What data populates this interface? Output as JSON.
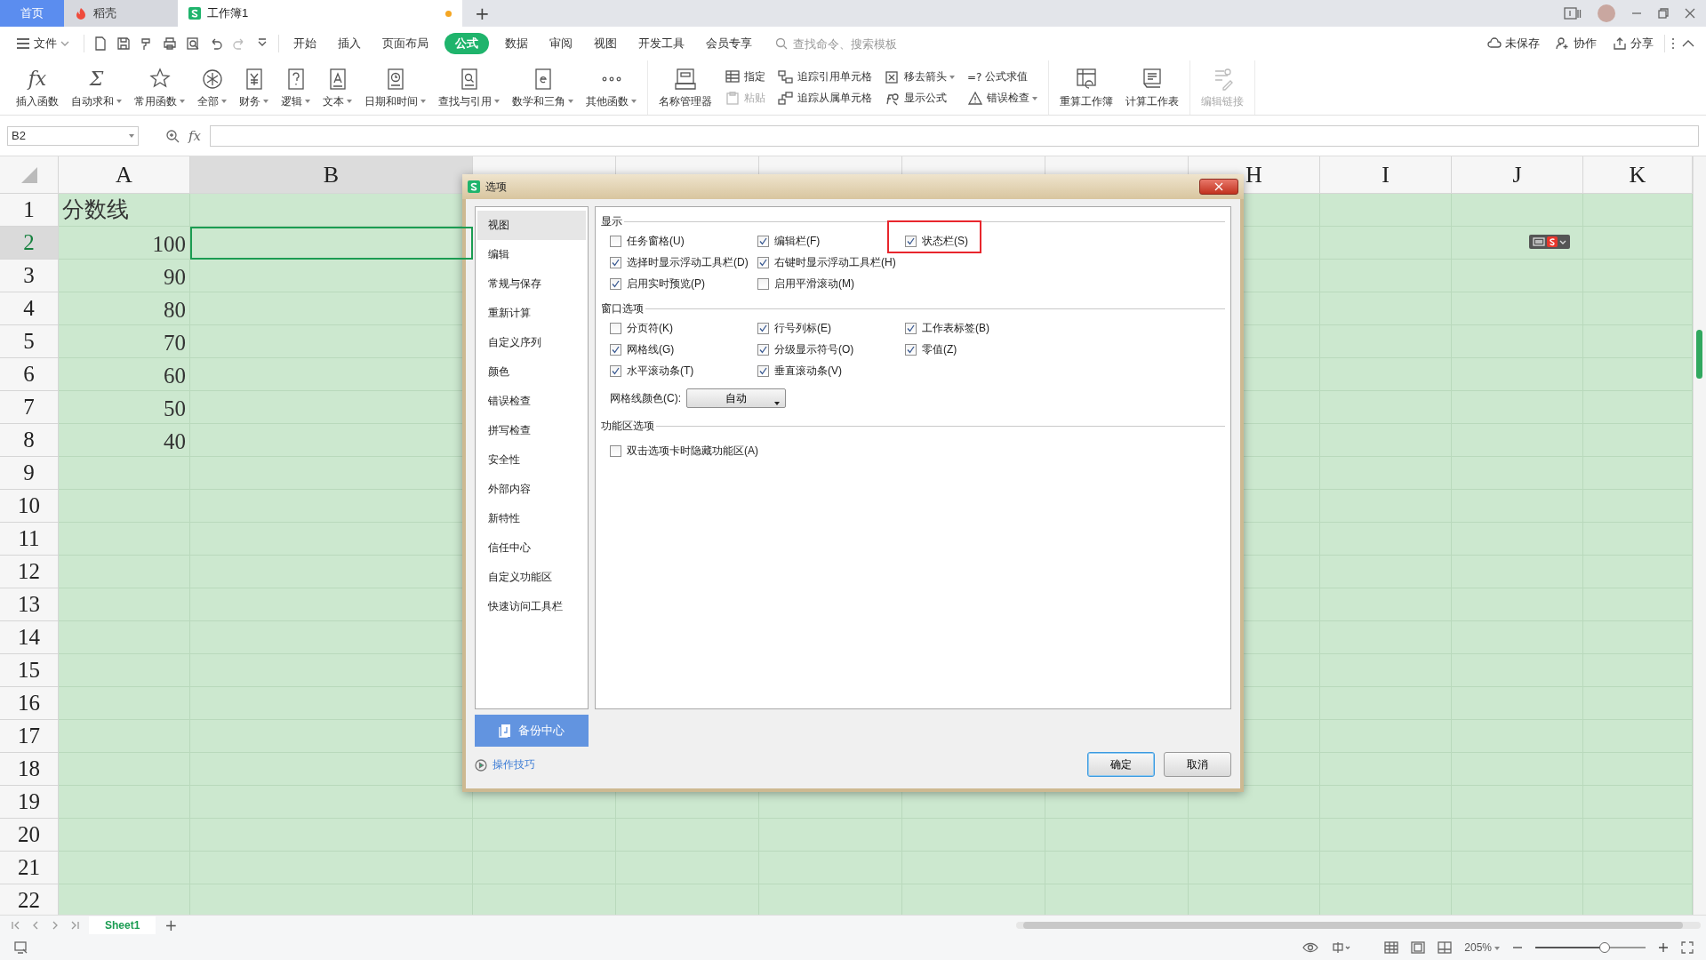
{
  "title_bar": {
    "tabs": [
      {
        "kind": "home",
        "label": "首页",
        "selected": false,
        "modified": false
      },
      {
        "kind": "docer",
        "label": "稻壳",
        "selected": false,
        "modified": false
      },
      {
        "kind": "workbook",
        "label": "工作簿1",
        "selected": true,
        "modified": true
      }
    ],
    "new_tab": "+"
  },
  "menu_bar": {
    "file": "文件",
    "tabs": [
      {
        "label": "开始",
        "selected": false
      },
      {
        "label": "插入",
        "selected": false
      },
      {
        "label": "页面布局",
        "selected": false
      },
      {
        "label": "公式",
        "selected": true
      },
      {
        "label": "数据",
        "selected": false
      },
      {
        "label": "审阅",
        "selected": false
      },
      {
        "label": "视图",
        "selected": false
      },
      {
        "label": "开发工具",
        "selected": false
      },
      {
        "label": "会员专享",
        "selected": false
      }
    ],
    "search": {
      "placeholder": "查找命令、搜索模板"
    },
    "actions": [
      "未保存",
      "协作",
      "分享"
    ]
  },
  "ribbon": {
    "groups": [
      {
        "items": [
          {
            "kind": "large",
            "label": "插入函数",
            "glyph": "fx",
            "dropdown": false,
            "disabled": false
          },
          {
            "kind": "large",
            "label": "自动求和",
            "glyph": "Σ",
            "dropdown": true,
            "disabled": false
          },
          {
            "kind": "large",
            "label": "常用函数",
            "dropdown": true,
            "disabled": false
          },
          {
            "kind": "large",
            "label": "全部",
            "dropdown": true,
            "disabled": false
          },
          {
            "kind": "large",
            "label": "财务",
            "dropdown": true,
            "disabled": false
          },
          {
            "kind": "large",
            "label": "逻辑",
            "dropdown": true,
            "disabled": false
          },
          {
            "kind": "large",
            "label": "文本",
            "dropdown": true,
            "disabled": false
          },
          {
            "kind": "large",
            "label": "日期和时间",
            "dropdown": true,
            "disabled": false
          },
          {
            "kind": "large",
            "label": "查找与引用",
            "dropdown": true,
            "disabled": false
          },
          {
            "kind": "large",
            "label": "数学和三角",
            "dropdown": true,
            "disabled": false
          },
          {
            "kind": "large",
            "label": "其他函数",
            "dropdown": true,
            "disabled": false
          }
        ]
      },
      {
        "items": [
          {
            "kind": "large",
            "label": "名称管理器",
            "dropdown": false,
            "disabled": false
          },
          {
            "kind": "small",
            "label": "指定",
            "dropdown": false,
            "disabled": false
          },
          {
            "kind": "small",
            "label": "粘贴",
            "dropdown": false,
            "disabled": true
          },
          {
            "kind": "small",
            "label": "追踪引用单元格",
            "dropdown": false,
            "disabled": false
          },
          {
            "kind": "small",
            "label": "追踪从属单元格",
            "dropdown": false,
            "disabled": false
          },
          {
            "kind": "small",
            "label": "移去箭头",
            "dropdown": true,
            "disabled": false
          },
          {
            "kind": "small",
            "label": "显示公式",
            "dropdown": false,
            "disabled": false
          },
          {
            "kind": "small",
            "label": "公式求值",
            "glyph": "=?",
            "dropdown": false,
            "disabled": false
          },
          {
            "kind": "small",
            "label": "错误检查",
            "dropdown": true,
            "disabled": false
          }
        ]
      },
      {
        "items": [
          {
            "kind": "large",
            "label": "重算工作簿",
            "dropdown": false,
            "disabled": false
          },
          {
            "kind": "large",
            "label": "计算工作表",
            "dropdown": false,
            "disabled": false
          }
        ]
      },
      {
        "items": [
          {
            "kind": "large",
            "label": "编辑链接",
            "dropdown": false,
            "disabled": true
          }
        ]
      }
    ]
  },
  "formula_bar": {
    "name_box": "B2",
    "function_glyph": "fx"
  },
  "sheet": {
    "columns": [
      {
        "label": "A",
        "selected": false
      },
      {
        "label": "B",
        "selected": true
      },
      {
        "selected": false
      },
      {
        "selected": false
      },
      {
        "selected": false
      },
      {
        "selected": false
      },
      {
        "selected": false
      },
      {
        "label": "H",
        "selected": false
      },
      {
        "label": "I",
        "selected": false
      },
      {
        "label": "J",
        "selected": false
      },
      {
        "label": "K",
        "selected": false
      }
    ],
    "rows": [
      {
        "label": "1",
        "selected": false,
        "cells": [
          {
            "text": "分数线",
            "selected": false
          }
        ]
      },
      {
        "label": "2",
        "selected": true,
        "cells": [
          {
            "text": "100",
            "selected": false
          },
          {
            "selected": true
          }
        ]
      },
      {
        "label": "3",
        "selected": false,
        "cells": [
          {
            "text": "90",
            "selected": false
          }
        ]
      },
      {
        "label": "4",
        "selected": false,
        "cells": [
          {
            "text": "80",
            "selected": false
          }
        ]
      },
      {
        "label": "5",
        "selected": false,
        "cells": [
          {
            "text": "70",
            "selected": false
          }
        ]
      },
      {
        "label": "6",
        "selected": false,
        "cells": [
          {
            "text": "60",
            "selected": false
          }
        ]
      },
      {
        "label": "7",
        "selected": false,
        "cells": [
          {
            "text": "50",
            "selected": false
          }
        ]
      },
      {
        "label": "8",
        "selected": false,
        "cells": [
          {
            "text": "40",
            "selected": false
          }
        ]
      },
      {
        "label": "9",
        "selected": false
      },
      {
        "label": "10",
        "selected": false
      },
      {
        "label": "11",
        "selected": false
      },
      {
        "label": "12",
        "selected": false
      },
      {
        "label": "13",
        "selected": false
      },
      {
        "label": "14",
        "selected": false
      },
      {
        "label": "15",
        "selected": false
      },
      {
        "label": "16",
        "selected": false
      },
      {
        "label": "17",
        "selected": false
      },
      {
        "label": "18",
        "selected": false
      },
      {
        "label": "19",
        "selected": false
      },
      {
        "label": "20",
        "selected": false
      },
      {
        "label": "21",
        "selected": false
      },
      {
        "label": "22",
        "selected": false
      }
    ]
  },
  "dialog": {
    "title": "选项",
    "nav": [
      {
        "label": "视图",
        "selected": true
      },
      {
        "label": "编辑",
        "selected": false
      },
      {
        "label": "常规与保存",
        "selected": false
      },
      {
        "label": "重新计算",
        "selected": false
      },
      {
        "label": "自定义序列",
        "selected": false
      },
      {
        "label": "颜色",
        "selected": false
      },
      {
        "label": "错误检查",
        "selected": false
      },
      {
        "label": "拼写检查",
        "selected": false
      },
      {
        "label": "安全性",
        "selected": false
      },
      {
        "label": "外部内容",
        "selected": false
      },
      {
        "label": "新特性",
        "selected": false
      },
      {
        "label": "信任中心",
        "selected": false
      },
      {
        "label": "自定义功能区",
        "selected": false
      },
      {
        "label": "快速访问工具栏",
        "selected": false
      }
    ],
    "backup_button": "备份中心",
    "tips_link": "操作技巧",
    "sections": [
      {
        "title": "显示",
        "rows": [
          [
            {
              "label": "任务窗格(U)",
              "checked": false,
              "highlighted": false
            },
            {
              "label": "编辑栏(F)",
              "checked": true,
              "highlighted": false
            },
            {
              "label": "状态栏(S)",
              "checked": true,
              "highlighted": true
            }
          ],
          [
            {
              "label": "选择时显示浮动工具栏(D)",
              "checked": true,
              "highlighted": false
            },
            {
              "label": "右键时显示浮动工具栏(H)",
              "checked": true,
              "highlighted": false
            }
          ],
          [
            {
              "label": "启用实时预览(P)",
              "checked": true,
              "highlighted": false
            },
            {
              "label": "启用平滑滚动(M)",
              "checked": false,
              "highlighted": false
            }
          ]
        ]
      },
      {
        "title": "窗口选项",
        "rows": [
          [
            {
              "label": "分页符(K)",
              "checked": false,
              "highlighted": false
            },
            {
              "label": "行号列标(E)",
              "checked": true,
              "highlighted": false
            },
            {
              "label": "工作表标签(B)",
              "checked": true,
              "highlighted": false
            }
          ],
          [
            {
              "label": "网格线(G)",
              "checked": true,
              "highlighted": false
            },
            {
              "label": "分级显示符号(O)",
              "checked": true,
              "highlighted": false
            },
            {
              "label": "零值(Z)",
              "checked": true,
              "highlighted": false
            }
          ],
          [
            {
              "label": "水平滚动条(T)",
              "checked": true,
              "highlighted": false
            },
            {
              "label": "垂直滚动条(V)",
              "checked": true,
              "highlighted": false
            }
          ]
        ],
        "select": {
          "label": "网格线颜色(C):",
          "value": "自动"
        }
      },
      {
        "title": "功能区选项",
        "rows": [
          [
            {
              "label": "双击选项卡时隐藏功能区(A)",
              "checked": false,
              "highlighted": false
            }
          ]
        ]
      }
    ],
    "buttons": [
      {
        "label": "确定",
        "default": true
      },
      {
        "label": "取消",
        "default": false
      }
    ]
  },
  "sheet_tabs": {
    "tabs": [
      {
        "label": "Sheet1",
        "selected": true
      }
    ],
    "add": "+"
  },
  "status_bar": {
    "zoom": "205%",
    "zoom_slider": {
      "level": 0.63
    }
  }
}
